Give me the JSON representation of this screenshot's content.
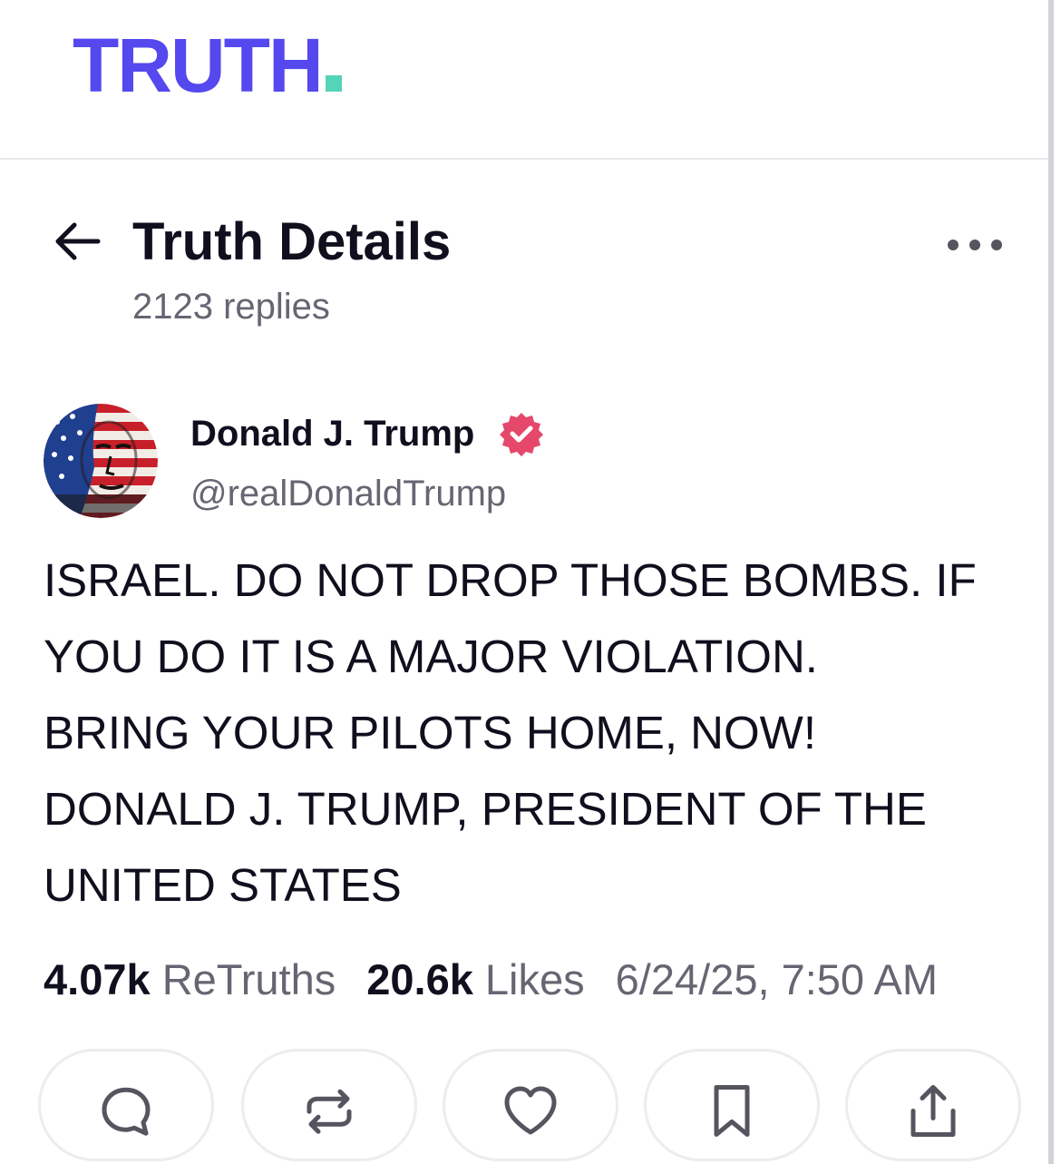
{
  "header": {
    "logo_text": "TRUTH",
    "logo_color": "#5448ee",
    "logo_dot_color": "#56d4b8"
  },
  "title_bar": {
    "back_icon": "arrow-left-icon",
    "title": "Truth Details",
    "subtitle": "2123 replies",
    "more_icon": "more-horizontal-icon"
  },
  "post": {
    "author": {
      "name": "Donald J. Trump",
      "handle": "@realDonaldTrump",
      "verified_icon": "verified-badge-icon",
      "verified_color": "#e5486a"
    },
    "text": "ISRAEL. DO NOT DROP THOSE BOMBS. IF\nYOU DO IT IS A MAJOR VIOLATION.\nBRING YOUR PILOTS HOME, NOW!\nDONALD J. TRUMP, PRESIDENT OF THE\nUNITED STATES",
    "stats": {
      "retruths_count": "4.07k",
      "retruths_label": "ReTruths",
      "likes_count": "20.6k",
      "likes_label": "Likes",
      "timestamp": "6/24/25, 7:50 AM"
    }
  },
  "actions": [
    {
      "icon": "reply-icon"
    },
    {
      "icon": "retruth-icon"
    },
    {
      "icon": "like-icon"
    },
    {
      "icon": "bookmark-icon"
    },
    {
      "icon": "share-icon"
    }
  ]
}
